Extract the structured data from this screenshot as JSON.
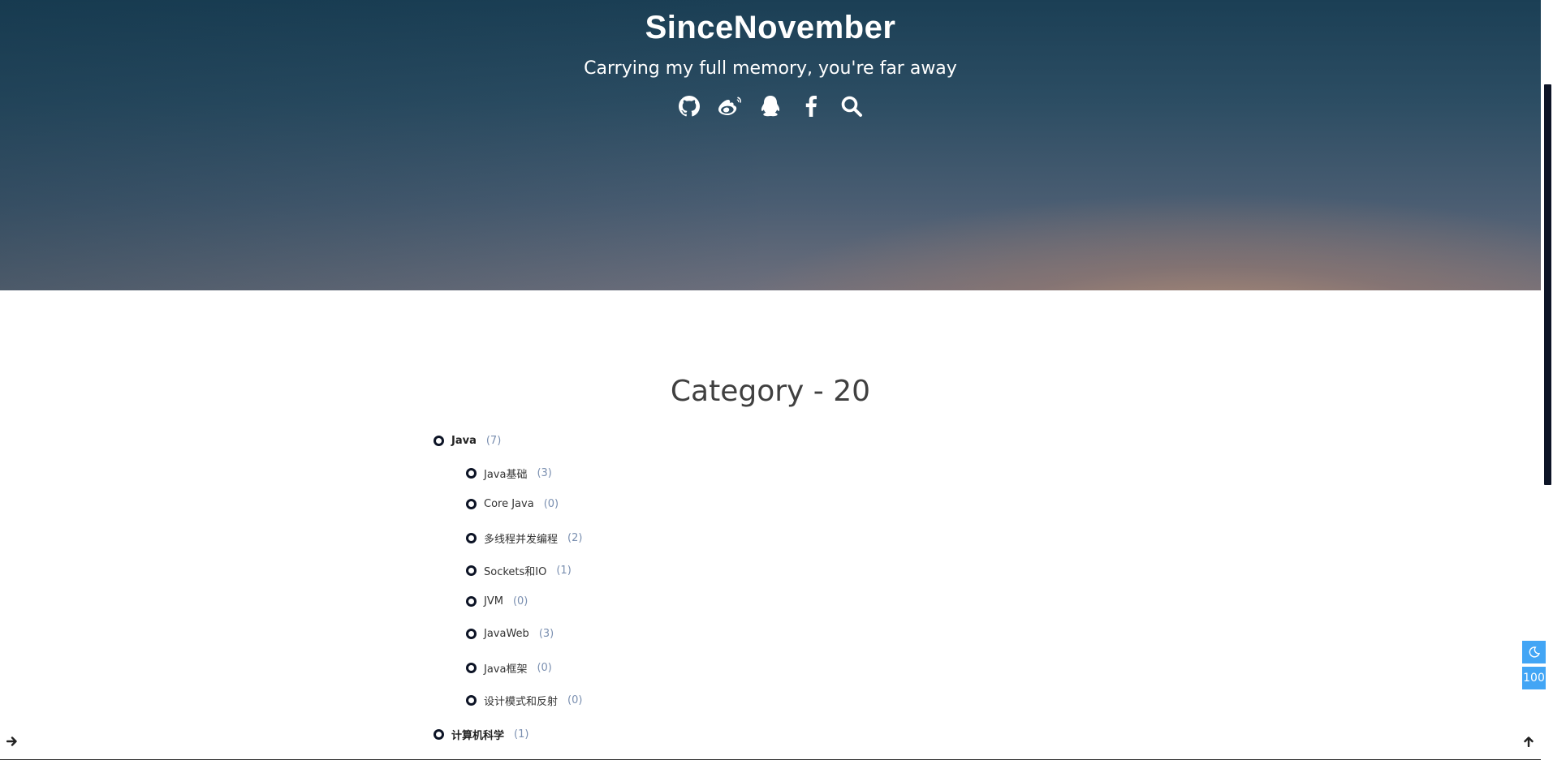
{
  "header": {
    "title": "SinceNovember",
    "subtitle": "Carrying my full memory, you're far away",
    "social_icons": [
      "github-icon",
      "weibo-icon",
      "qq-icon",
      "facebook-icon",
      "search-icon"
    ]
  },
  "page": {
    "heading": "Category - 20"
  },
  "categories": [
    {
      "name": "Java",
      "count": "(7)",
      "level": 1
    },
    {
      "name": "Java基础",
      "count": "(3)",
      "level": 2
    },
    {
      "name": "Core Java",
      "count": "(0)",
      "level": 2
    },
    {
      "name": "多线程并发编程",
      "count": "(2)",
      "level": 2
    },
    {
      "name": "Sockets和IO",
      "count": "(1)",
      "level": 2
    },
    {
      "name": "JVM",
      "count": "(0)",
      "level": 2
    },
    {
      "name": "JavaWeb",
      "count": "(3)",
      "level": 2
    },
    {
      "name": "Java框架",
      "count": "(0)",
      "level": 2
    },
    {
      "name": "设计模式和反射",
      "count": "(0)",
      "level": 2
    },
    {
      "name": "计算机科学",
      "count": "(1)",
      "level": 1
    }
  ],
  "widgets": {
    "dark_mode_icon": "moon-icon",
    "progress_label": "100",
    "toggle_sidebar_icon": "arrow-right-icon",
    "back_to_top_icon": "arrow-up-icon"
  },
  "colors": {
    "accent": "#42a5f5",
    "bullet": "#0d1426",
    "count": "#7a8fb0"
  }
}
